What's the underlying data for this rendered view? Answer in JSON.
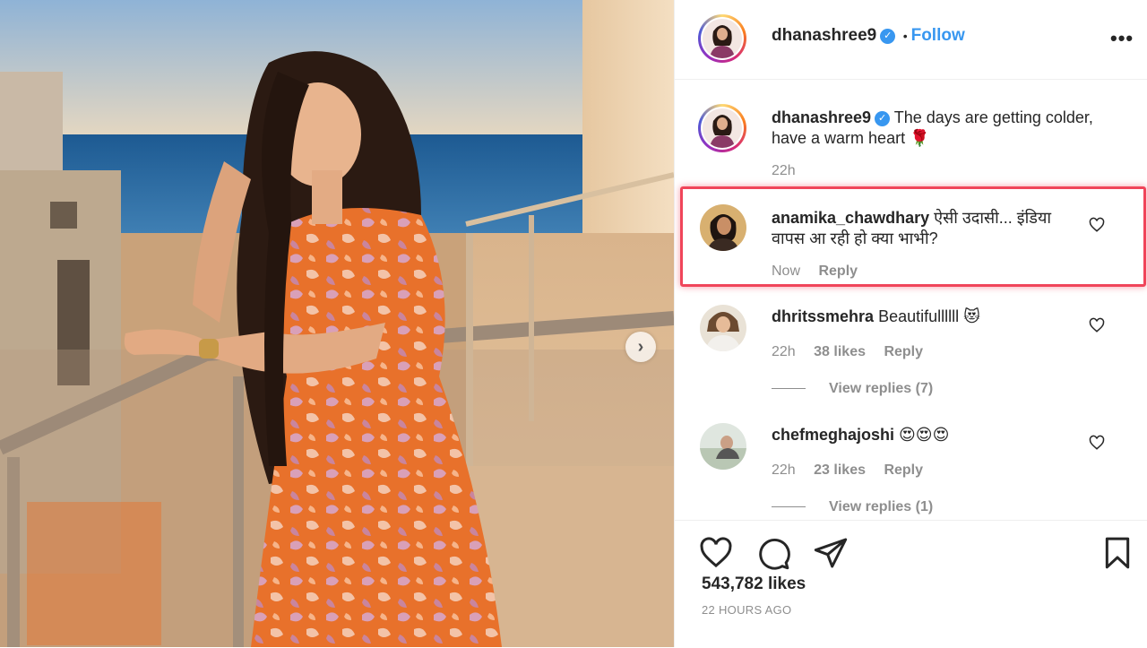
{
  "post": {
    "author": "dhanashree9",
    "verified_mark": "✓",
    "follow_separator": "•",
    "follow_label": "Follow",
    "more_label": "•••",
    "caption_text": "The days are getting colder, have a warm heart 🌹",
    "caption_time": "22h"
  },
  "comments": [
    {
      "username": "anamika_chawdhary",
      "text": "ऐसी उदासी... इंडिया वापस आ रही हो क्या भाभी?",
      "time": "Now",
      "likes": "",
      "reply_label": "Reply",
      "view_replies": ""
    },
    {
      "username": "dhritssmehra",
      "text": "Beautifullllll 😻",
      "time": "22h",
      "likes": "38 likes",
      "reply_label": "Reply",
      "view_replies": "View replies (7)"
    },
    {
      "username": "chefmeghajoshi",
      "text": "😍😍😍",
      "time": "22h",
      "likes": "23 likes",
      "reply_label": "Reply",
      "view_replies": "View replies (1)"
    }
  ],
  "footer": {
    "likes": "543,782 likes",
    "timestamp": "22 HOURS AGO"
  },
  "icons": {
    "like": "heart-icon",
    "comment": "comment-icon",
    "share": "share-icon",
    "save": "bookmark-icon",
    "next": "chevron-right-icon"
  },
  "colors": {
    "accent": "#3897f0",
    "highlight": "#f0455a",
    "muted": "#8e8e8e",
    "text": "#262626"
  }
}
